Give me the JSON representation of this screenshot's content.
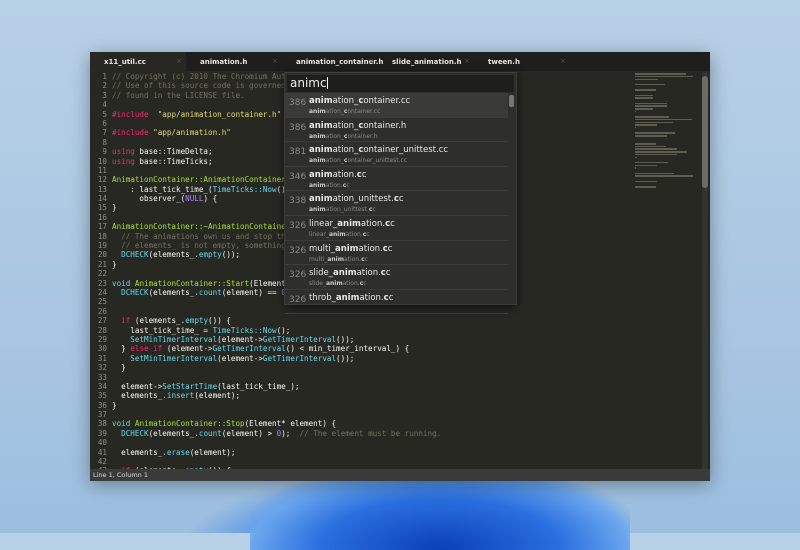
{
  "tabs": [
    {
      "label": "x11_util.cc"
    },
    {
      "label": "animation.h"
    },
    {
      "label": "animation_container.h"
    },
    {
      "label": "slide_animation.h"
    },
    {
      "label": "tween.h"
    }
  ],
  "tab_close_glyph": "×",
  "status": "Line 1, Column 1",
  "goto": {
    "query": "animc"
  },
  "results": [
    {
      "score": "386",
      "name": [
        [
          "anim",
          1
        ],
        [
          "ation_",
          0
        ],
        [
          "c",
          1
        ],
        [
          "ontainer.cc",
          0
        ]
      ],
      "path": [
        [
          "anim",
          1
        ],
        [
          "ation_",
          0
        ],
        [
          "c",
          1
        ],
        [
          "ontainer.cc",
          0
        ]
      ]
    },
    {
      "score": "386",
      "name": [
        [
          "anim",
          1
        ],
        [
          "ation_",
          0
        ],
        [
          "c",
          1
        ],
        [
          "ontainer.h",
          0
        ]
      ],
      "path": [
        [
          "anim",
          1
        ],
        [
          "ation_",
          0
        ],
        [
          "c",
          1
        ],
        [
          "ontainer.h",
          0
        ]
      ]
    },
    {
      "score": "381",
      "name": [
        [
          "anim",
          1
        ],
        [
          "ation_",
          0
        ],
        [
          "c",
          1
        ],
        [
          "ontainer_unittest.cc",
          0
        ]
      ],
      "path": [
        [
          "anim",
          1
        ],
        [
          "ation_",
          0
        ],
        [
          "c",
          1
        ],
        [
          "ontainer_unittest.cc",
          0
        ]
      ]
    },
    {
      "score": "346",
      "name": [
        [
          "anim",
          1
        ],
        [
          "ation.",
          0
        ],
        [
          "c",
          1
        ],
        [
          "c",
          0
        ]
      ],
      "path": [
        [
          "anim",
          1
        ],
        [
          "ation.",
          0
        ],
        [
          "c",
          1
        ],
        [
          "c",
          0
        ]
      ]
    },
    {
      "score": "338",
      "name": [
        [
          "anim",
          1
        ],
        [
          "ation_unittest.",
          0
        ],
        [
          "c",
          1
        ],
        [
          "c",
          0
        ]
      ],
      "path": [
        [
          "anim",
          1
        ],
        [
          "ation_unittest.",
          0
        ],
        [
          "c",
          1
        ],
        [
          "c",
          0
        ]
      ]
    },
    {
      "score": "326",
      "name": [
        [
          "linear_",
          0
        ],
        [
          "anim",
          1
        ],
        [
          "ation.",
          0
        ],
        [
          "c",
          1
        ],
        [
          "c",
          0
        ]
      ],
      "path": [
        [
          "linear_",
          0
        ],
        [
          "anim",
          1
        ],
        [
          "ation.",
          0
        ],
        [
          "c",
          1
        ],
        [
          "c",
          0
        ]
      ]
    },
    {
      "score": "326",
      "name": [
        [
          "multi_",
          0
        ],
        [
          "anim",
          1
        ],
        [
          "ation.",
          0
        ],
        [
          "c",
          1
        ],
        [
          "c",
          0
        ]
      ],
      "path": [
        [
          "multi_",
          0
        ],
        [
          "anim",
          1
        ],
        [
          "ation.",
          0
        ],
        [
          "c",
          1
        ],
        [
          "c",
          0
        ]
      ]
    },
    {
      "score": "326",
      "name": [
        [
          "slide_",
          0
        ],
        [
          "anim",
          1
        ],
        [
          "ation.",
          0
        ],
        [
          "c",
          1
        ],
        [
          "c",
          0
        ]
      ],
      "path": [
        [
          "slide_",
          0
        ],
        [
          "anim",
          1
        ],
        [
          "ation.",
          0
        ],
        [
          "c",
          1
        ],
        [
          "c",
          0
        ]
      ]
    },
    {
      "score": "326",
      "name": [
        [
          "throb_",
          0
        ],
        [
          "anim",
          1
        ],
        [
          "ation.",
          0
        ],
        [
          "c",
          1
        ],
        [
          "c",
          0
        ]
      ],
      "path": []
    }
  ],
  "code": [
    [
      [
        "c",
        "// Copyright (c) 2010 The Chromium Authors. All rights reserved."
      ]
    ],
    [
      [
        "c",
        "// Use of this source code is governed by a BSD-style license that can be"
      ]
    ],
    [
      [
        "c",
        "// found in the LICENSE file."
      ]
    ],
    [],
    [
      [
        "k",
        "#include"
      ],
      [
        "",
        "  "
      ],
      [
        "s",
        "\"app/animation_container.h\""
      ]
    ],
    [],
    [
      [
        "k",
        "#include"
      ],
      [
        "",
        ""
      ],
      [
        "s",
        " \"app/animation.h\""
      ]
    ],
    [],
    [
      [
        "k",
        "using"
      ],
      [
        "",
        " base::TimeDelta;"
      ]
    ],
    [
      [
        "k",
        "using"
      ],
      [
        "",
        " base::TimeTicks;"
      ]
    ],
    [],
    [
      [
        "f",
        "AnimationContainer::AnimationContainer()"
      ]
    ],
    [
      [
        "",
        "    : last_tick_time_("
      ],
      [
        "b",
        "TimeTicks::Now"
      ],
      [
        "",
        "()),"
      ]
    ],
    [
      [
        "",
        "      observer_("
      ],
      [
        "n",
        "NULL"
      ],
      [
        "",
        ") {"
      ]
    ],
    [
      [
        "",
        "}"
      ]
    ],
    [],
    [
      [
        "f",
        "AnimationContainer::~AnimationContainer() {"
      ]
    ],
    [
      [
        "c",
        "  // The animations own us and stop themselves before being deleted. If"
      ]
    ],
    [
      [
        "c",
        "  // elements_ is not empty, something is wrong."
      ]
    ],
    [
      [
        "",
        "  "
      ],
      [
        "b",
        "DCHECK"
      ],
      [
        "",
        "(elements_."
      ],
      [
        "b",
        "empty"
      ],
      [
        "",
        "());"
      ]
    ],
    [
      [
        "",
        "}"
      ]
    ],
    [],
    [
      [
        "b",
        "void"
      ],
      [
        "",
        " "
      ],
      [
        "f",
        "AnimationContainer::Start"
      ],
      [
        "",
        "(Element* element) {"
      ]
    ],
    [
      [
        "",
        "  "
      ],
      [
        "b",
        "DCHECK"
      ],
      [
        "",
        "(elements_."
      ],
      [
        "b",
        "count"
      ],
      [
        "",
        "(element) == "
      ],
      [
        "n",
        "0"
      ],
      [
        "",
        ");"
      ]
    ],
    [],
    [],
    [
      [
        "",
        "  "
      ],
      [
        "k",
        "if"
      ],
      [
        "",
        " (elements_."
      ],
      [
        "b",
        "empty"
      ],
      [
        "",
        "()) {"
      ]
    ],
    [
      [
        "",
        "    last_tick_time_ = "
      ],
      [
        "b",
        "TimeTicks::Now"
      ],
      [
        "",
        "();"
      ]
    ],
    [
      [
        "",
        "    "
      ],
      [
        "b",
        "SetMinTimerInterval"
      ],
      [
        "",
        "(element->"
      ],
      [
        "b",
        "GetTimerInterval"
      ],
      [
        "",
        "());"
      ]
    ],
    [
      [
        "",
        "  } "
      ],
      [
        "k",
        "else if"
      ],
      [
        "",
        " (element->"
      ],
      [
        "b",
        "GetTimerInterval"
      ],
      [
        "",
        "() < min_timer_interval_) {"
      ]
    ],
    [
      [
        "",
        "    "
      ],
      [
        "b",
        "SetMinTimerInterval"
      ],
      [
        "",
        "(element->"
      ],
      [
        "b",
        "GetTimerInterval"
      ],
      [
        "",
        "());"
      ]
    ],
    [
      [
        "",
        "  }"
      ]
    ],
    [],
    [
      [
        "",
        "  element->"
      ],
      [
        "b",
        "SetStartTime"
      ],
      [
        "",
        "(last_tick_time_);"
      ]
    ],
    [
      [
        "",
        "  elements_."
      ],
      [
        "b",
        "insert"
      ],
      [
        "",
        "(element);"
      ]
    ],
    [
      [
        "",
        "}"
      ]
    ],
    [],
    [
      [
        "b",
        "void"
      ],
      [
        "",
        " "
      ],
      [
        "f",
        "AnimationContainer::Stop"
      ],
      [
        "",
        "(Element* element) {"
      ]
    ],
    [
      [
        "",
        "  "
      ],
      [
        "b",
        "DCHECK"
      ],
      [
        "",
        "(elements_."
      ],
      [
        "b",
        "count"
      ],
      [
        "",
        "(element) > "
      ],
      [
        "n",
        "0"
      ],
      [
        "",
        ");  "
      ],
      [
        "c",
        "// The element must be running."
      ]
    ],
    [],
    [
      [
        "",
        "  elements_."
      ],
      [
        "b",
        "erase"
      ],
      [
        "",
        "(element);"
      ]
    ],
    [],
    [
      [
        "",
        "  "
      ],
      [
        "k",
        "if"
      ],
      [
        "",
        " (elements_."
      ],
      [
        "b",
        "empty"
      ],
      [
        "",
        "()) {"
      ]
    ]
  ],
  "colors": {
    "background": "#272822",
    "comment": "#75715e",
    "keyword": "#f92672",
    "string": "#e6db74",
    "function": "#a6e22e",
    "builtin": "#66d9ef",
    "number": "#ae81ff"
  }
}
